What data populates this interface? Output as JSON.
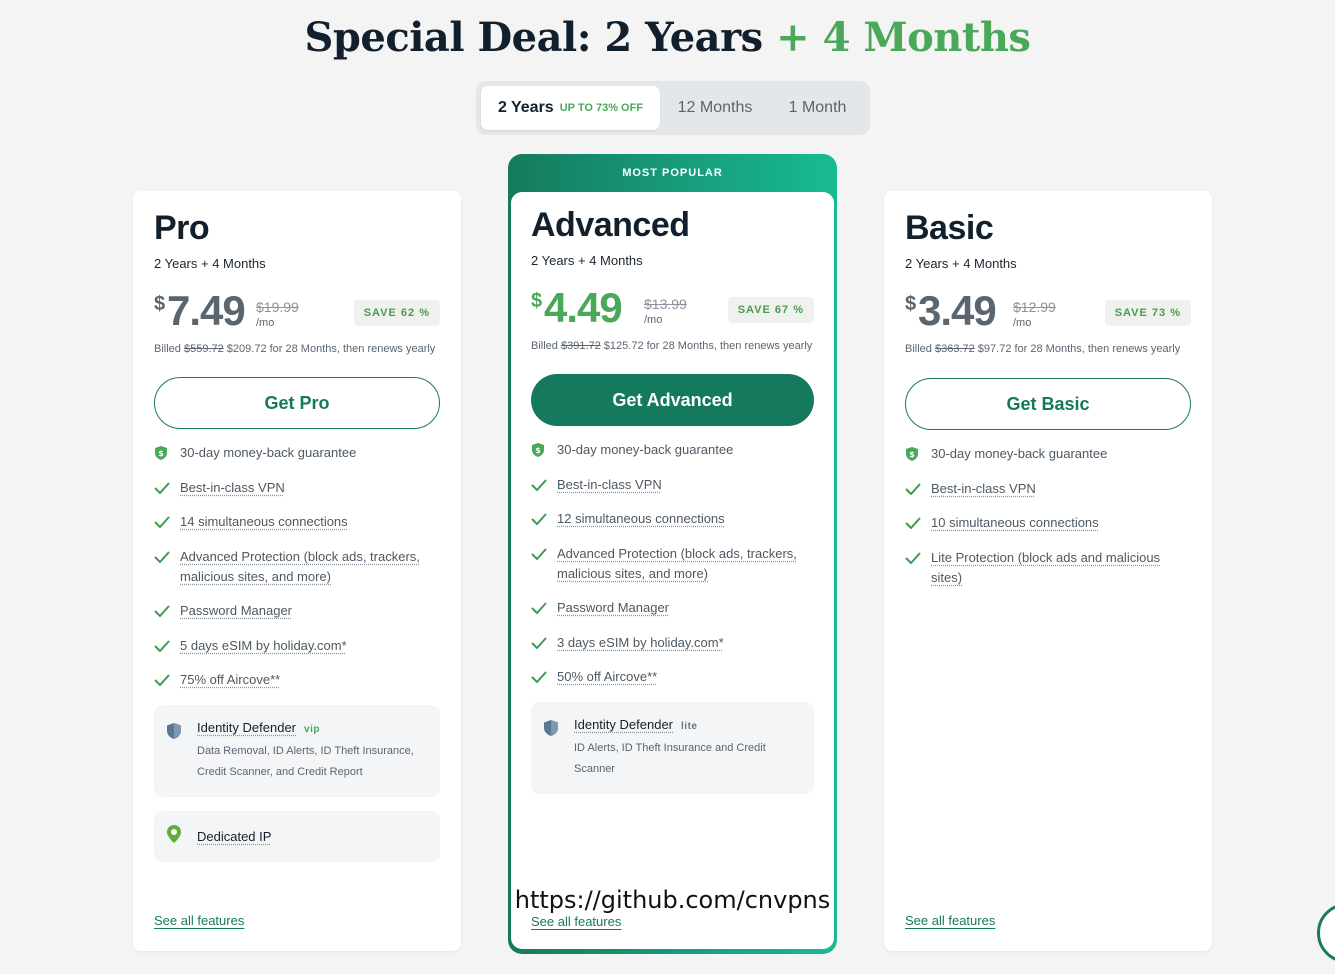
{
  "headline": {
    "main": "Special Deal: 2 Years",
    "accent": "+ 4 Months"
  },
  "term_toggle": {
    "options": [
      {
        "label": "2 Years",
        "badge": "UP TO 73% OFF",
        "selected": true
      },
      {
        "label": "12 Months"
      },
      {
        "label": "1 Month"
      }
    ]
  },
  "plans": {
    "pro": {
      "name": "Pro",
      "term": "2 Years + 4 Months",
      "currency": "$",
      "price": "7.49",
      "was": "$19.99",
      "per": "/mo",
      "save": "SAVE 62 %",
      "billed_prefix": "Billed",
      "billed_was": "$559.72",
      "billed_rest": "$209.72 for 28 Months, then renews yearly",
      "cta": "Get Pro",
      "features": [
        "30-day money-back guarantee",
        "Best-in-class VPN",
        "14 simultaneous connections",
        "Advanced Protection (block ads, trackers, malicious sites, and more)",
        "Password Manager",
        "5 days eSIM by holiday.com*",
        "75% off Aircove**"
      ],
      "identity": {
        "title": "Identity Defender",
        "tag": "vip",
        "desc": "Data Removal, ID Alerts, ID Theft Insurance, Credit Scanner, and Credit Report"
      },
      "dedicated_ip": "Dedicated IP",
      "see_all": "See all features"
    },
    "advanced": {
      "banner": "MOST POPULAR",
      "name": "Advanced",
      "term": "2 Years + 4 Months",
      "currency": "$",
      "price": "4.49",
      "was": "$13.99",
      "per": "/mo",
      "save": "SAVE 67 %",
      "billed_prefix": "Billed",
      "billed_was": "$391.72",
      "billed_rest": "$125.72 for 28 Months, then renews yearly",
      "cta": "Get Advanced",
      "features": [
        "30-day money-back guarantee",
        "Best-in-class VPN",
        "12 simultaneous connections",
        "Advanced Protection (block ads, trackers, malicious sites, and more)",
        "Password Manager",
        "3 days eSIM by holiday.com*",
        "50% off Aircove**"
      ],
      "identity": {
        "title": "Identity Defender",
        "tag": "lite",
        "desc": "ID Alerts, ID Theft Insurance and Credit Scanner"
      },
      "see_all": "See all features"
    },
    "basic": {
      "name": "Basic",
      "term": "2 Years + 4 Months",
      "currency": "$",
      "price": "3.49",
      "was": "$12.99",
      "per": "/mo",
      "save": "SAVE 73 %",
      "billed_prefix": "Billed",
      "billed_was": "$363.72",
      "billed_rest": "$97.72 for 28 Months, then renews yearly",
      "cta": "Get Basic",
      "features": [
        "30-day money-back guarantee",
        "Best-in-class VPN",
        "10 simultaneous connections",
        "Lite Protection (block ads and malicious sites)"
      ],
      "see_all": "See all features"
    }
  },
  "watermark": "https://github.com/cnvpns",
  "colors": {
    "brand_green": "#157a5d",
    "accent_green": "#4aa85a",
    "background": "#f4f4f4"
  }
}
